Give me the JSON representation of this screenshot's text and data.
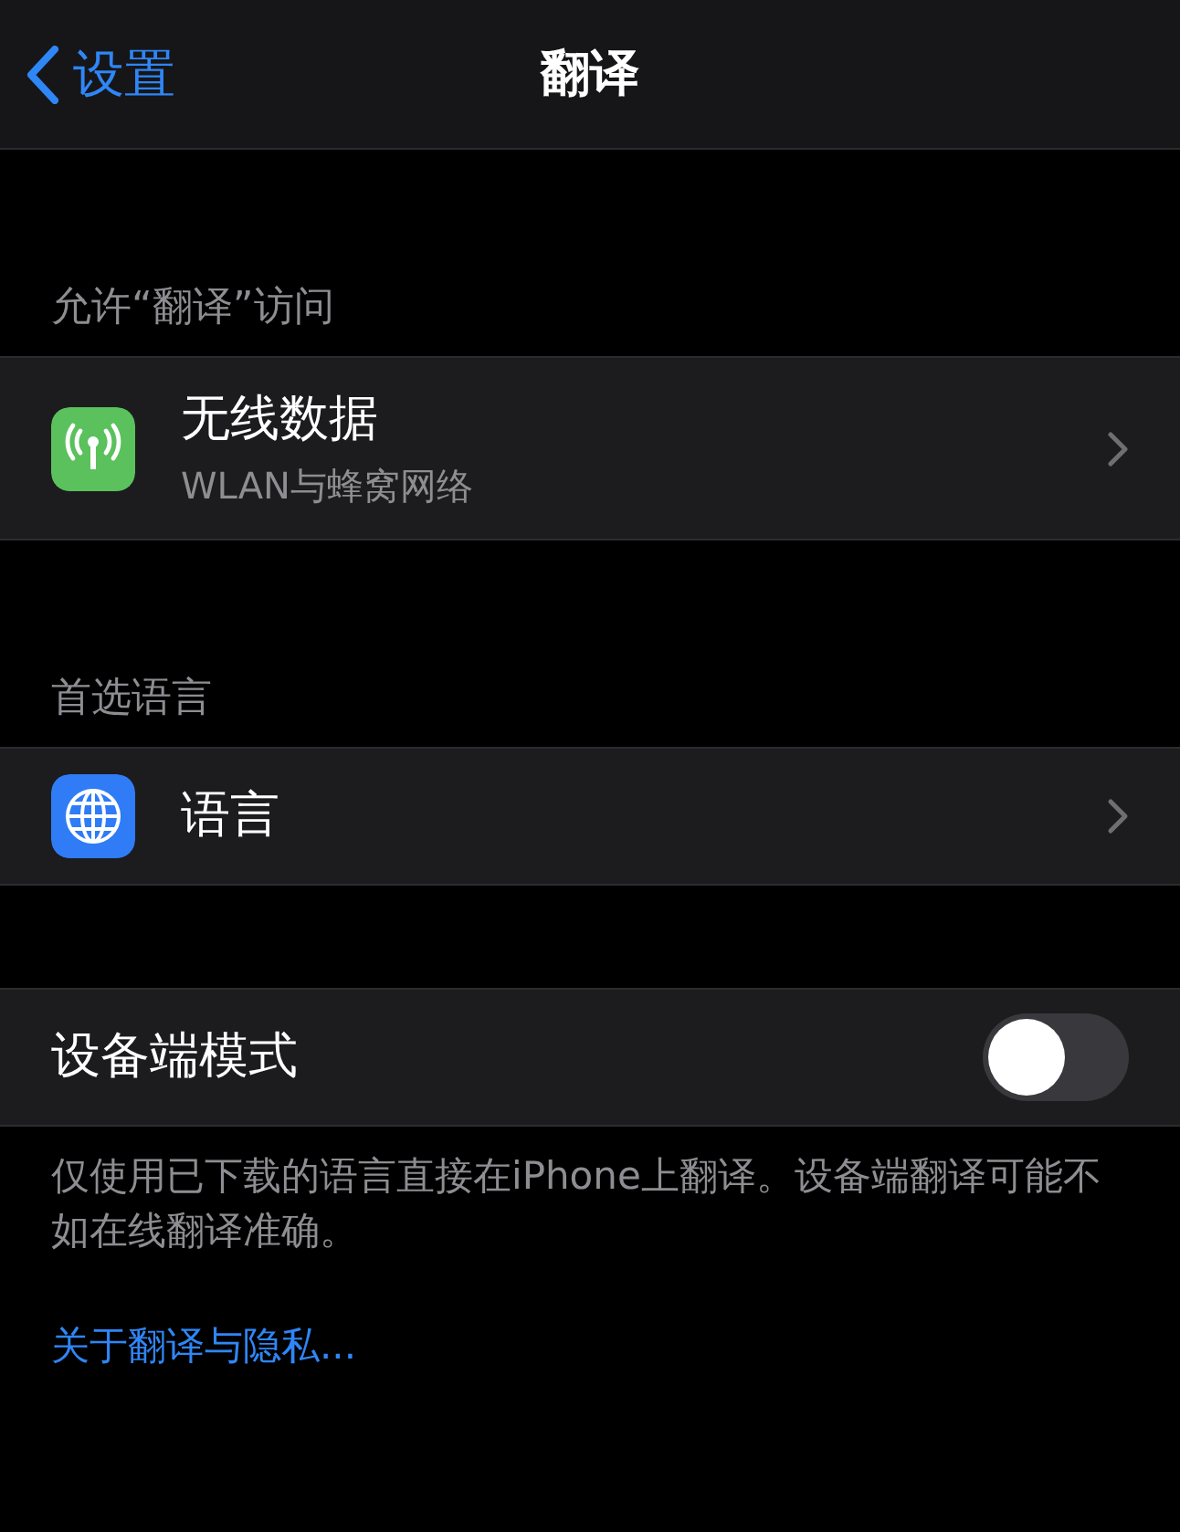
{
  "nav": {
    "back": "设置",
    "title": "翻译"
  },
  "sections": [
    {
      "header": "允许“翻译”访问",
      "rows": [
        {
          "kind": "link",
          "title": "无线数据",
          "subtitle": "WLAN与蜂窝网络"
        }
      ]
    },
    {
      "header": "首选语言",
      "rows": [
        {
          "kind": "link",
          "title": "语言"
        }
      ]
    },
    {
      "rows": [
        {
          "kind": "toggle",
          "title": "设备端模式",
          "on": false
        }
      ],
      "footer": "仅使用已下载的语言直接在iPhone上翻译。设备端翻译可能不如在线翻译准确。",
      "link": "关于翻译与隐私..."
    }
  ]
}
